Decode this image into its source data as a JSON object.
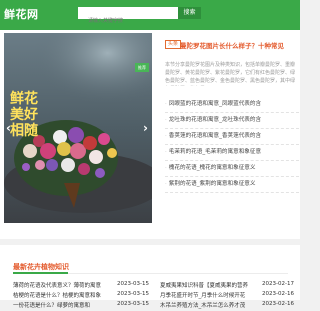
{
  "header": {
    "logo": "鲜花网",
    "search_placeholder": "请输入关键字搜",
    "search_button": "搜索"
  },
  "slider": {
    "image_text": [
      "鲜花",
      "美好",
      "相随"
    ],
    "badge": "推荐",
    "prev_arrow": "‹",
    "next_arrow": "›",
    "active_dot": 0
  },
  "news": {
    "tag": "头条",
    "headline": "曼陀罗花图片长什么样子？十种常见",
    "summary": "本节分享曼陀罗花图片及种类知识，包括单瓣曼陀罗、重瓣曼陀罗、黄花曼陀罗、紫花曼陀罗，它们有红色曼陀罗、绿色曼陀罗、蓝色曼陀罗、金色曼陀罗、黑色曼陀罗，其中绿色曼陀罗、紫色曼",
    "items": [
      "凤眼蓝的花语和寓意_凤眼蓝代表的含",
      "龙吐珠的花语和寓意_龙吐珠代表的含",
      "香荚蒾的花语和寓意_香荚蒾代表的含",
      "毛茉莉的花语_毛茉莉的寓意和象征意",
      "槐花的花语_槐花的寓意和象征意义",
      "紫荆的花语_紫荆的寓意和象征意义"
    ]
  },
  "section": {
    "title": "最新花卉植物知识",
    "rows": [
      {
        "title": "薄荷的花语及代表意义？薄荷的寓意",
        "date": "2023-03-15"
      },
      {
        "title": "夏威夷果知识科普【夏威夷果的营养",
        "date": "2023-02-17"
      },
      {
        "title": "桔梗的花语是什么？桔梗的寓意和象",
        "date": "2023-03-15"
      },
      {
        "title": "月季花盛开时节_月季什么时候开花",
        "date": "2023-02-16"
      },
      {
        "title": "一份花语是什么？绿萝的寓意和",
        "date": "2023-03-15"
      },
      {
        "title": "木吊兰养殖方法_木吊兰怎么养才茂",
        "date": "2023-02-16"
      }
    ]
  }
}
